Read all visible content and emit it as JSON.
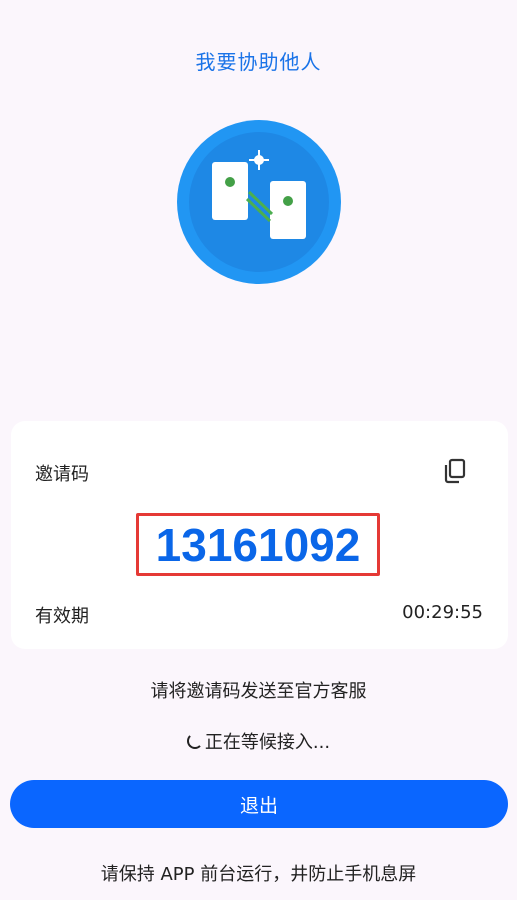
{
  "header": {
    "title": "我要协助他人"
  },
  "invite_card": {
    "code_label": "邀请码",
    "code_value": "13161092",
    "validity_label": "有效期",
    "validity_time": "00:29:55"
  },
  "instruction_text": "请将邀请码发送至官方客服",
  "status": {
    "waiting_text": "正在等候接入..."
  },
  "exit_button_label": "退出",
  "footer_note": "请保持 APP 前台运行，井防止手机息屏",
  "colors": {
    "accent": "#0a66ff",
    "title_blue": "#1a73e8",
    "highlight_border": "#e53935",
    "background": "#fbf6fc"
  },
  "icons": {
    "hero": "assist-devices-icon",
    "copy": "copy-icon"
  }
}
